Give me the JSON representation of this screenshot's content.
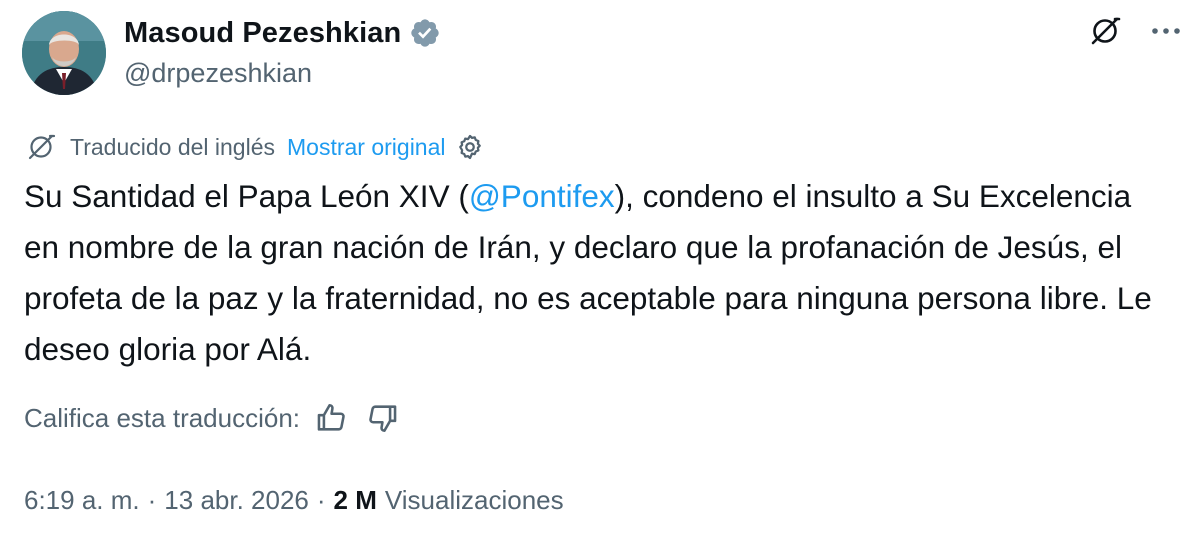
{
  "user": {
    "display_name": "Masoud Pezeshkian",
    "handle": "@drpezeshkian",
    "verified_badge_icon": "verified-gray-badge-icon",
    "verified_color": "#829aab"
  },
  "top_actions": {
    "translate_icon": "no-translate-icon",
    "more_icon": "more-dots-icon"
  },
  "translation": {
    "label": "Traducido del inglés",
    "show_original": "Mostrar original",
    "settings_icon": "gear-icon"
  },
  "tweet": {
    "text_before": "Su Santidad el Papa León XIV (",
    "mention": "@Pontifex",
    "text_after": "), condeno el insulto a Su Excelencia en nombre de la gran nación de Irán, y declaro que la profanación de Jesús, el profeta de la paz y la fraternidad, no es aceptable para ninguna persona libre. Le deseo gloria por Alá."
  },
  "rating": {
    "label": "Califica esta traducción:",
    "thumbs_up_icon": "thumbs-up-icon",
    "thumbs_down_icon": "thumbs-down-icon"
  },
  "meta": {
    "time": "6:19 a. m.",
    "separator": "·",
    "date": "13 abr. 2026",
    "views_count": "2 M",
    "views_label": "Visualizaciones"
  },
  "colors": {
    "text": "#0f1419",
    "secondary": "#536471",
    "link": "#1d9bf0"
  }
}
